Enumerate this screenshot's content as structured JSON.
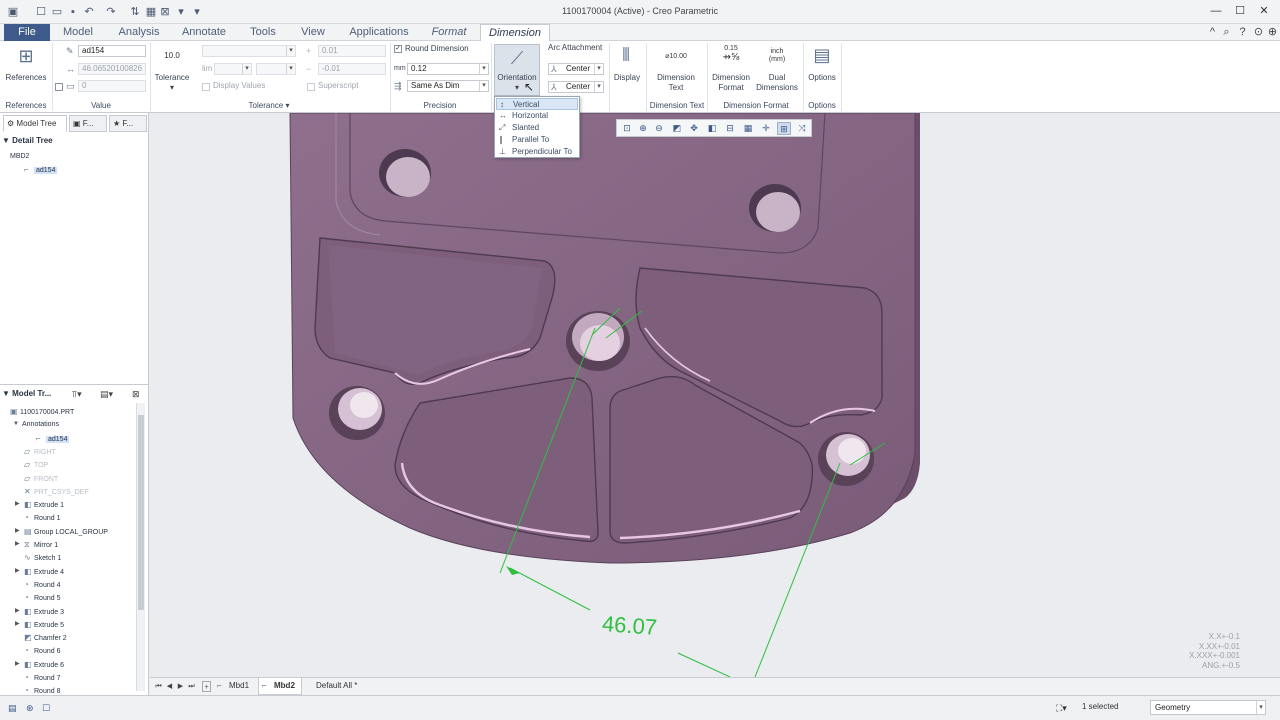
{
  "window": {
    "title": "1100170004 (Active) - Creo Parametric"
  },
  "tabs": [
    "File",
    "Model",
    "Analysis",
    "Annotate",
    "Tools",
    "View",
    "Applications",
    "Format",
    "Dimension"
  ],
  "ribbon": {
    "references_label": "References",
    "value": {
      "name": "ad154",
      "nominal": "46.06520100826",
      "override": "0",
      "group_label": "Value"
    },
    "tolerance": {
      "button_label": "Tolerance",
      "icon_text": "10.0",
      "upper": "0.01",
      "lower": "-0.01",
      "lim_label": "lim",
      "display_values": "Display Values",
      "superscript": "Superscript",
      "group_label": "Tolerance"
    },
    "precision": {
      "round_dimension": "Round Dimension",
      "mm_label": "mm",
      "decimals": "0.12",
      "same_as": "Same As Dim",
      "group_label": "Precision"
    },
    "orientation_label": "Orientation",
    "arc_attachment": {
      "label": "Arc Attachment",
      "first": "Center",
      "second": "Center"
    },
    "display_label": "Display",
    "dimension_text": {
      "button_label": "Dimension Text",
      "icon_text": "⌀10.00",
      "group_label": "Dimension Text"
    },
    "dimension_format": {
      "format_label": "Dimension Format",
      "format_icon_top": "0.15",
      "dual_label": "Dual Dimensions",
      "dual_icon_top": "inch",
      "dual_icon_bottom": "(mm)",
      "group_label": "Dimension Format"
    },
    "options": {
      "button_label": "Options",
      "group_label": "Options"
    }
  },
  "orientation_menu": [
    "Vertical",
    "Horizontal",
    "Slanted",
    "Parallel To",
    "Perpendicular To"
  ],
  "left_panel": {
    "tabs": [
      "Model Tree",
      "F...",
      "F..."
    ],
    "detail_tree": {
      "title": "Detail Tree",
      "root": "MBD2",
      "items": [
        "ad154"
      ]
    },
    "model_tree": {
      "title": "Model Tr...",
      "items": [
        {
          "label": "1100170004.PRT",
          "icon": "part-icon",
          "faded": false,
          "expand": ""
        },
        {
          "label": "Annotations",
          "icon": "",
          "faded": false,
          "expand": "▼"
        },
        {
          "label": "ad154",
          "icon": "dim-icon",
          "faded": false,
          "expand": "",
          "selected": true
        },
        {
          "label": "RIGHT",
          "icon": "plane-icon",
          "faded": true,
          "expand": ""
        },
        {
          "label": "TOP",
          "icon": "plane-icon",
          "faded": true,
          "expand": ""
        },
        {
          "label": "FRONT",
          "icon": "plane-icon",
          "faded": true,
          "expand": ""
        },
        {
          "label": "PRT_CSYS_DEF",
          "icon": "csys-icon",
          "faded": true,
          "expand": ""
        },
        {
          "label": "Extrude 1",
          "icon": "extrude-icon",
          "faded": false,
          "expand": "▶"
        },
        {
          "label": "Round 1",
          "icon": "round-icon",
          "faded": false,
          "expand": ""
        },
        {
          "label": "Group LOCAL_GROUP",
          "icon": "group-icon",
          "faded": false,
          "expand": "▶"
        },
        {
          "label": "Mirror 1",
          "icon": "mirror-icon",
          "faded": false,
          "expand": "▶"
        },
        {
          "label": "Sketch 1",
          "icon": "sketch-icon",
          "faded": false,
          "expand": ""
        },
        {
          "label": "Extrude 4",
          "icon": "extrude-icon",
          "faded": false,
          "expand": "▶"
        },
        {
          "label": "Round 4",
          "icon": "round-icon",
          "faded": false,
          "expand": ""
        },
        {
          "label": "Round 5",
          "icon": "round-icon",
          "faded": false,
          "expand": ""
        },
        {
          "label": "Extrude 3",
          "icon": "extrude-icon",
          "faded": false,
          "expand": "▶"
        },
        {
          "label": "Extrude 5",
          "icon": "extrude-icon",
          "faded": false,
          "expand": "▶"
        },
        {
          "label": "Chamfer 2",
          "icon": "chamfer-icon",
          "faded": false,
          "expand": ""
        },
        {
          "label": "Round 6",
          "icon": "round-icon",
          "faded": false,
          "expand": ""
        },
        {
          "label": "Extrude 6",
          "icon": "extrude-icon",
          "faded": false,
          "expand": "▶"
        },
        {
          "label": "Round 7",
          "icon": "round-icon",
          "faded": false,
          "expand": ""
        },
        {
          "label": "Round 8",
          "icon": "round-icon",
          "faded": false,
          "expand": ""
        }
      ]
    }
  },
  "viewport": {
    "dimension_value": "46.07",
    "tolerance_table": [
      "X.X+-0.1",
      "X.XX+-0.01",
      "X.XXX+-0.001",
      "ANG.+-0.5"
    ],
    "colors": {
      "part": "#8a6a86",
      "dimension": "#2fbf3f",
      "background": "#eaecef"
    }
  },
  "model_tabs": [
    "Mbd1",
    "Mbd2",
    "Default All *"
  ],
  "status": {
    "selected": "1 selected",
    "filter": "Geometry"
  },
  "colors": {
    "file_tab": "#3e5a8a",
    "accent": "#4e5f78",
    "selection": "#cfe2f7"
  }
}
